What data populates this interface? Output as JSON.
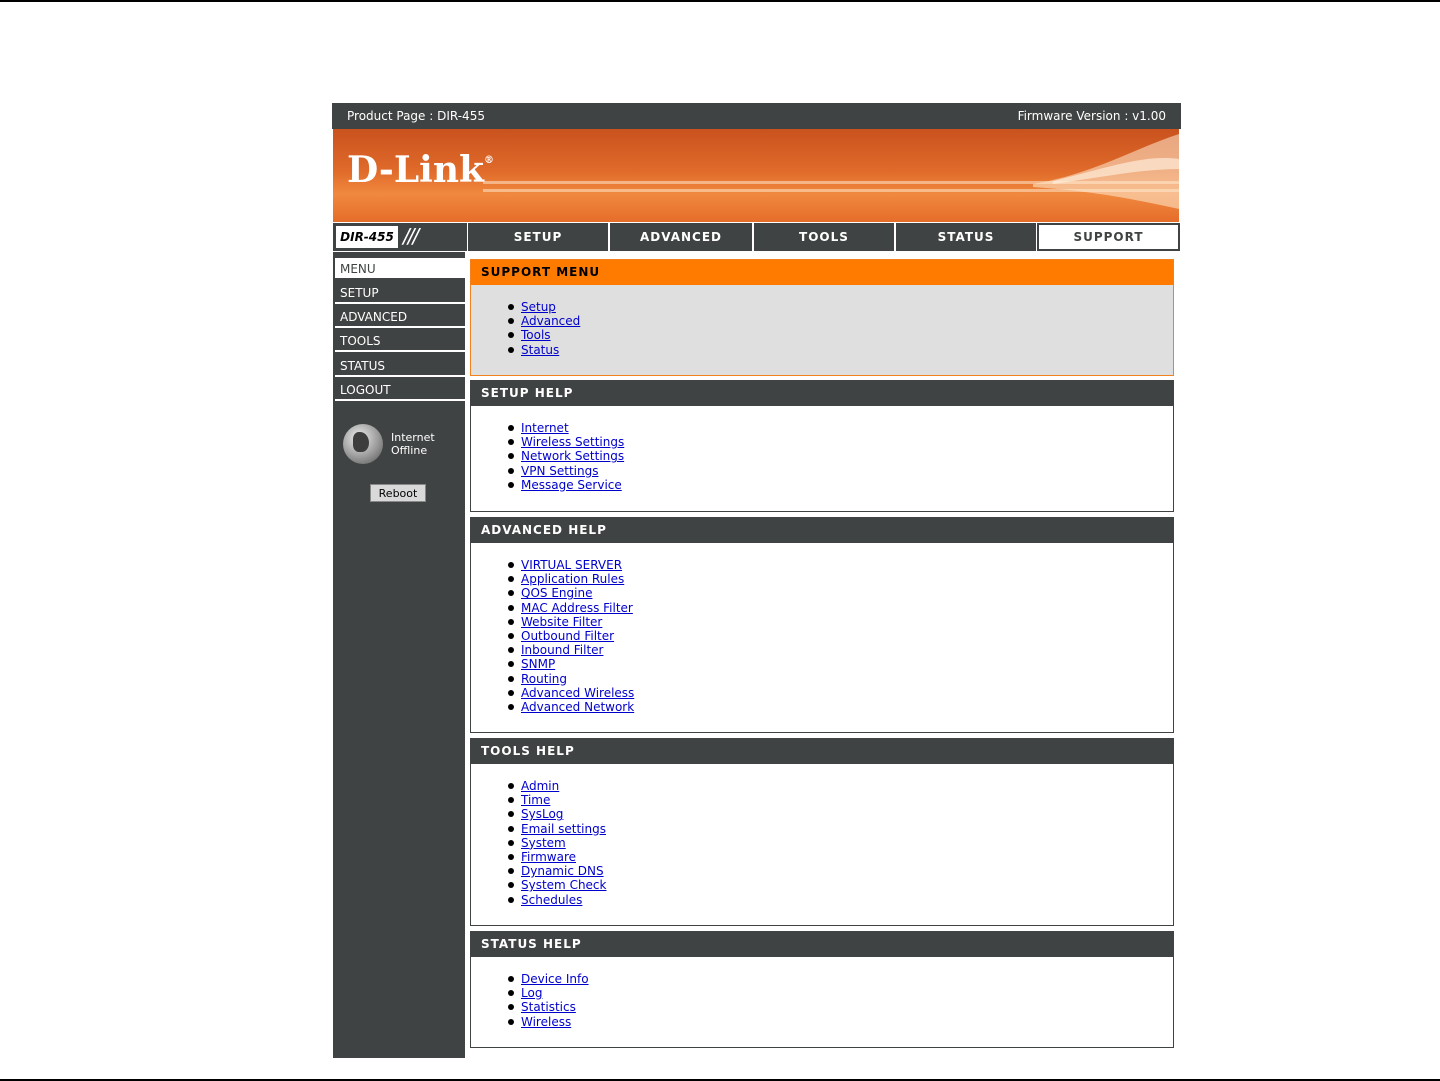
{
  "header": {
    "product_page": "Product Page : DIR-455",
    "firmware_version": "Firmware Version : v1.00"
  },
  "brand": {
    "logo": "D-Link",
    "registered": "®"
  },
  "model": {
    "name": "DIR-455",
    "decoration": "///"
  },
  "tabs": [
    {
      "label": "SETUP"
    },
    {
      "label": "ADVANCED"
    },
    {
      "label": "TOOLS"
    },
    {
      "label": "STATUS"
    },
    {
      "label": "SUPPORT",
      "active": true
    }
  ],
  "sidebar": {
    "items": [
      {
        "label": "MENU"
      },
      {
        "label": "SETUP"
      },
      {
        "label": "ADVANCED"
      },
      {
        "label": "TOOLS"
      },
      {
        "label": "STATUS"
      },
      {
        "label": "LOGOUT"
      }
    ],
    "internet_label": "Internet",
    "internet_status": "Offline",
    "reboot_label": "Reboot"
  },
  "sections": {
    "support_menu": {
      "title": "SUPPORT MENU",
      "links": [
        "Setup",
        "Advanced",
        "Tools",
        "Status"
      ]
    },
    "setup_help": {
      "title": "SETUP HELP",
      "links": [
        "Internet",
        "Wireless Settings",
        "Network Settings",
        "VPN Settings",
        "Message Service"
      ]
    },
    "advanced_help": {
      "title": "ADVANCED HELP",
      "links": [
        "VIRTUAL SERVER",
        "Application Rules",
        "QOS Engine",
        "MAC Address Filter",
        "Website Filter",
        "Outbound Filter",
        "Inbound Filter",
        "SNMP",
        "Routing",
        "Advanced Wireless",
        "Advanced Network"
      ]
    },
    "tools_help": {
      "title": "TOOLS HELP",
      "links": [
        "Admin",
        "Time",
        "SysLog",
        "Email settings",
        "System",
        "Firmware",
        "Dynamic DNS",
        "System Check",
        "Schedules"
      ]
    },
    "status_help": {
      "title": "STATUS HELP",
      "links": [
        "Device Info",
        "Log",
        "Statistics",
        "Wireless"
      ]
    }
  },
  "colors": {
    "dark": "#404343",
    "orange": "#ff7b00",
    "link": "#0000cc"
  }
}
